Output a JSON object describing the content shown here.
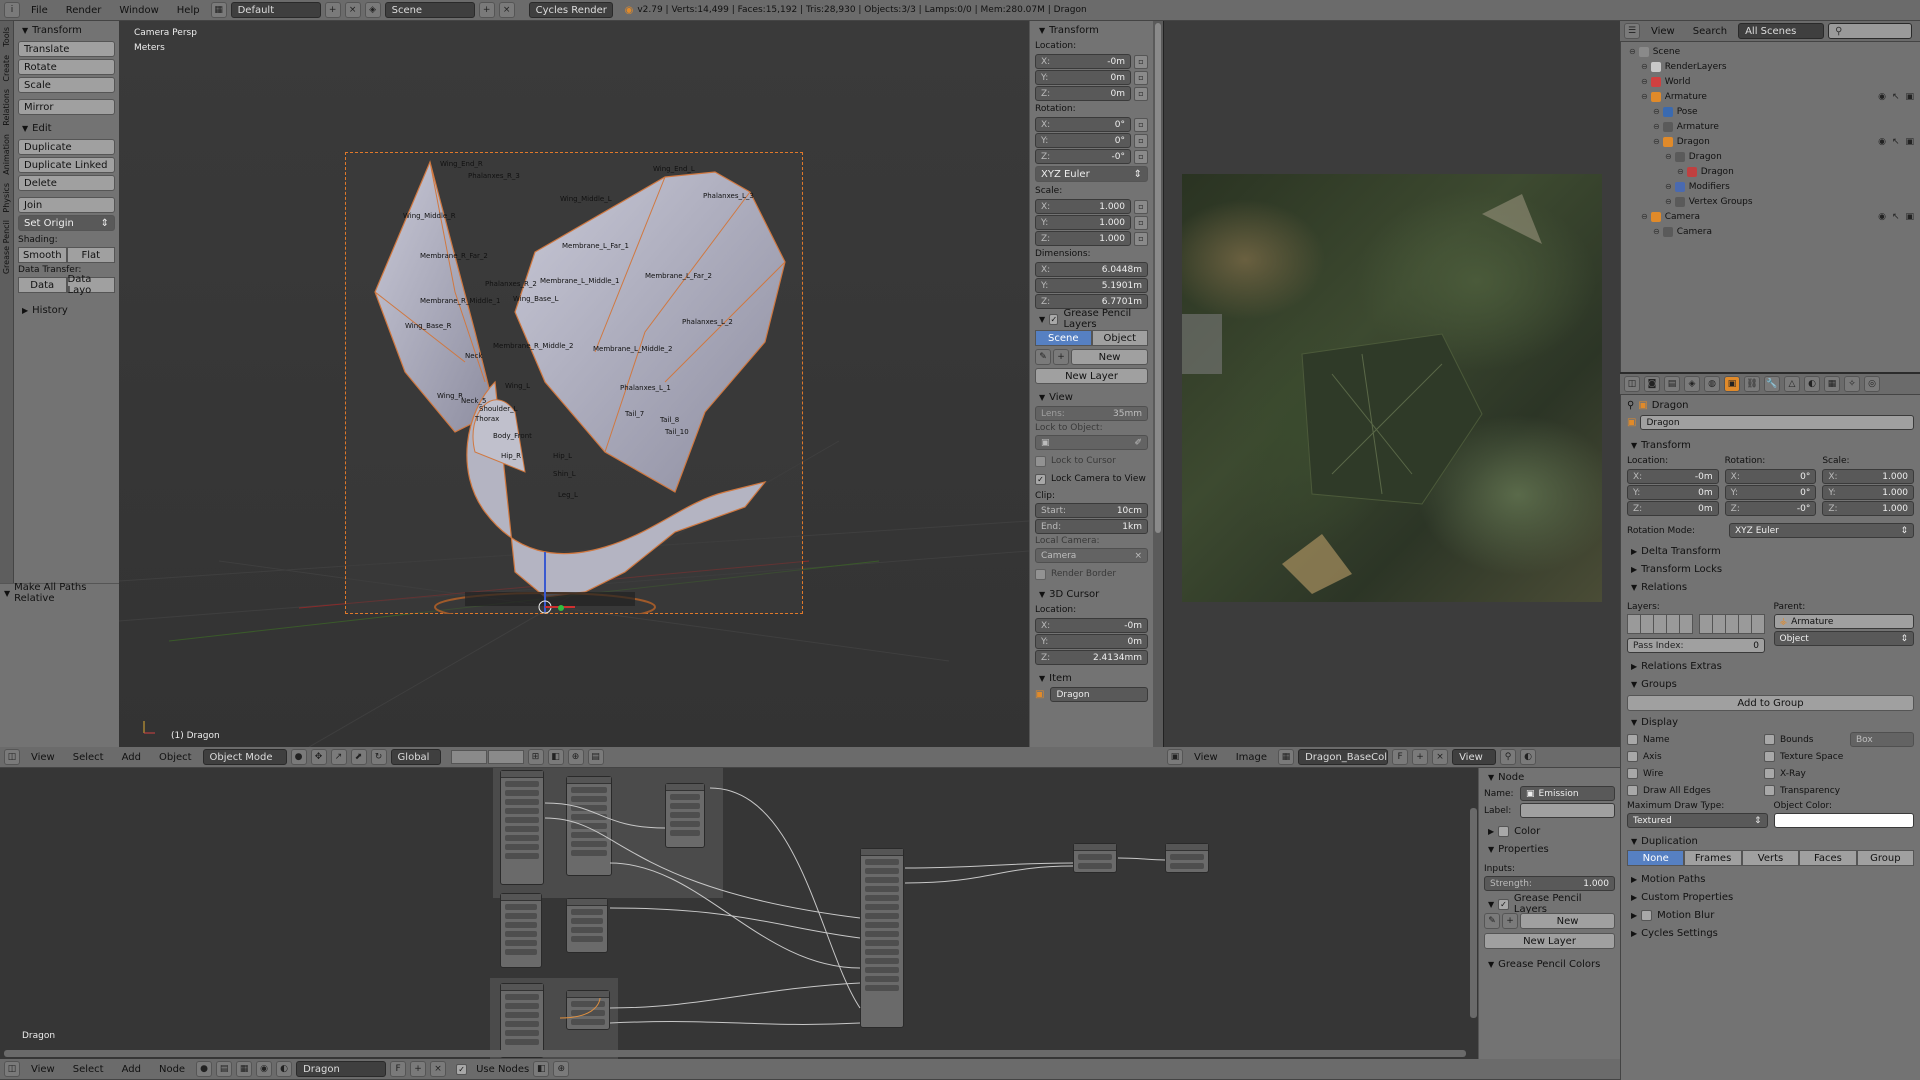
{
  "top": {
    "menus": [
      "File",
      "Render",
      "Window",
      "Help"
    ],
    "layout": "Default",
    "scene": "Scene",
    "engine": "Cycles Render",
    "stats": "v2.79 | Verts:14,499 | Faces:15,192 | Tris:28,930 | Objects:3/3 | Lamps:0/0 | Mem:280.07M | Dragon"
  },
  "toolshelf": {
    "tabs": [
      "Tools",
      "Create",
      "Relations",
      "Animation",
      "Physics",
      "Grease Pencil"
    ],
    "transform_title": "Transform",
    "translate": "Translate",
    "rotate": "Rotate",
    "scale": "Scale",
    "mirror": "Mirror",
    "edit_title": "Edit",
    "duplicate": "Duplicate",
    "duplicate_linked": "Duplicate Linked",
    "delete": "Delete",
    "join": "Join",
    "set_origin": "Set Origin",
    "shading": "Shading:",
    "smooth": "Smooth",
    "flat": "Flat",
    "data_transfer": "Data Transfer:",
    "data": "Data",
    "data_layo": "Data Layo",
    "history": "History",
    "make_paths": "Make All Paths Relative"
  },
  "viewport": {
    "persp": "Camera Persp",
    "units": "Meters",
    "object": "(1) Dragon",
    "header": {
      "menus": [
        "View",
        "Select",
        "Add",
        "Object"
      ],
      "mode": "Object Mode",
      "orient": "Global"
    },
    "bones": [
      "Wing_End_R",
      "Phalanxes_R_3",
      "Wing_End_L",
      "Phalanxes_L_3",
      "Wing_Middle_R",
      "Wing_Middle_L",
      "Membrane_L_Far_1",
      "Membrane_R_Far_2",
      "Membrane_L_Far_2",
      "Phalanxes_R_2",
      "Membrane_L_Middle_1",
      "Membrane_R_Middle_1",
      "Wing_Base_L",
      "Phalanxes_L_2",
      "Wing_Base_R",
      "Membrane_R_Middle_2",
      "Membrane_L_Middle_2",
      "Neck",
      "Wing_L",
      "Phalanxes_L_1",
      "Neck_5",
      "Wing_R",
      "Shoulder_L",
      "Thorax",
      "Body_Front",
      "Hip_R",
      "Hip_L",
      "Shin_L",
      "Leg_L",
      "Tail_7",
      "Tail_8",
      "Tail_10"
    ]
  },
  "npanel": {
    "transform": "Transform",
    "location": "Location:",
    "loc": [
      {
        "k": "X:",
        "v": "-0m"
      },
      {
        "k": "Y:",
        "v": "0m"
      },
      {
        "k": "Z:",
        "v": "0m"
      }
    ],
    "rotation": "Rotation:",
    "rot": [
      {
        "k": "X:",
        "v": "0°"
      },
      {
        "k": "Y:",
        "v": "0°"
      },
      {
        "k": "Z:",
        "v": "-0°"
      }
    ],
    "rotmode": "XYZ Euler",
    "scale": "Scale:",
    "scl": [
      {
        "k": "X:",
        "v": "1.000"
      },
      {
        "k": "Y:",
        "v": "1.000"
      },
      {
        "k": "Z:",
        "v": "1.000"
      }
    ],
    "dimensions": "Dimensions:",
    "dim": [
      {
        "k": "X:",
        "v": "6.0448m"
      },
      {
        "k": "Y:",
        "v": "5.1901m"
      },
      {
        "k": "Z:",
        "v": "6.7701m"
      }
    ],
    "gp": "Grease Pencil Layers",
    "scene": "Scene",
    "object": "Object",
    "new": "New",
    "new_layer": "New Layer",
    "view": "View",
    "lens": "Lens:",
    "lens_v": "35mm",
    "lock_obj": "Lock to Object:",
    "lock_cursor": "Lock to Cursor",
    "lock_cam": "Lock Camera to View",
    "clip": "Clip:",
    "start": "Start:",
    "start_v": "10cm",
    "end": "End:",
    "end_v": "1km",
    "local_cam": "Local Camera:",
    "camera": "Camera",
    "render_border": "Render Border",
    "cursor": "3D Cursor",
    "cursor_loc": "Location:",
    "cur": [
      {
        "k": "X:",
        "v": "-0m"
      },
      {
        "k": "Y:",
        "v": "0m"
      },
      {
        "k": "Z:",
        "v": "2.4134mm"
      }
    ],
    "item": "Item",
    "item_name": "Dragon"
  },
  "image_editor": {
    "menus": [
      "View",
      "Image"
    ],
    "image": "Dragon_BaseColor.p...",
    "view": "View"
  },
  "node_editor": {
    "menus": [
      "View",
      "Select",
      "Add",
      "Node"
    ],
    "material": "Dragon",
    "use_nodes": "Use Nodes",
    "label": "Dragon",
    "side": {
      "node": "Node",
      "name": "Name:",
      "name_v": "Emission",
      "label": "Label:",
      "color": "Color",
      "props": "Properties",
      "inputs": "Inputs:",
      "strength": "Strength:",
      "strength_v": "1.000",
      "gp": "Grease Pencil Layers",
      "new": "New",
      "new_layer": "New Layer",
      "gpc": "Grease Pencil Colors"
    }
  },
  "outliner": {
    "menus": [
      "View",
      "Search"
    ],
    "scope": "All Scenes",
    "items": [
      {
        "t": "Scene",
        "d": 0,
        "c": "#8a8a8a"
      },
      {
        "t": "RenderLayers",
        "d": 1,
        "c": "#c9c9c9"
      },
      {
        "t": "World",
        "d": 1,
        "c": "#d04040"
      },
      {
        "t": "Armature",
        "d": 1,
        "c": "#e08a2a"
      },
      {
        "t": "Pose",
        "d": 2,
        "c": "#3a6ab0"
      },
      {
        "t": "Armature",
        "d": 2,
        "c": "#5a5a5a"
      },
      {
        "t": "Dragon",
        "d": 2,
        "c": "#e08a2a"
      },
      {
        "t": "Dragon",
        "d": 3,
        "c": "#5a5a5a"
      },
      {
        "t": "Dragon",
        "d": 4,
        "c": "#c04040"
      },
      {
        "t": "Modifiers",
        "d": 3,
        "c": "#4a6ab0"
      },
      {
        "t": "Vertex Groups",
        "d": 3,
        "c": "#5a5a5a"
      },
      {
        "t": "Camera",
        "d": 1,
        "c": "#e08a2a"
      },
      {
        "t": "Camera",
        "d": 2,
        "c": "#5a5a5a"
      }
    ]
  },
  "props": {
    "crumb": "Dragon",
    "name": "Dragon",
    "transform": "Transform",
    "location": "Location:",
    "rotation": "Rotation:",
    "scale": "Scale:",
    "loc": [
      {
        "k": "X:",
        "v": "-0m"
      },
      {
        "k": "Y:",
        "v": "0m"
      },
      {
        "k": "Z:",
        "v": "0m"
      }
    ],
    "rot": [
      {
        "k": "X:",
        "v": "0°"
      },
      {
        "k": "Y:",
        "v": "0°"
      },
      {
        "k": "Z:",
        "v": "-0°"
      }
    ],
    "scl": [
      {
        "k": "X:",
        "v": "1.000"
      },
      {
        "k": "Y:",
        "v": "1.000"
      },
      {
        "k": "Z:",
        "v": "1.000"
      }
    ],
    "rotmode_l": "Rotation Mode:",
    "rotmode": "XYZ Euler",
    "delta": "Delta Transform",
    "locks": "Transform Locks",
    "relations": "Relations",
    "layers": "Layers:",
    "parent": "Parent:",
    "parent_v": "Armature",
    "parent_type": "Object",
    "pass": "Pass Index:",
    "pass_v": "0",
    "rel_extras": "Relations Extras",
    "groups": "Groups",
    "add_group": "Add to Group",
    "display": "Display",
    "name_c": "Name",
    "axis": "Axis",
    "wire": "Wire",
    "draw_edges": "Draw All Edges",
    "bounds": "Bounds",
    "box": "Box",
    "tex_space": "Texture Space",
    "xray": "X-Ray",
    "transparency": "Transparency",
    "max_draw": "Maximum Draw Type:",
    "textured": "Textured",
    "obj_color": "Object Color:",
    "duplication": "Duplication",
    "dup": [
      "None",
      "Frames",
      "Verts",
      "Faces",
      "Group"
    ],
    "motion_paths": "Motion Paths",
    "custom": "Custom Properties",
    "motion_blur": "Motion Blur",
    "cycles": "Cycles Settings"
  }
}
